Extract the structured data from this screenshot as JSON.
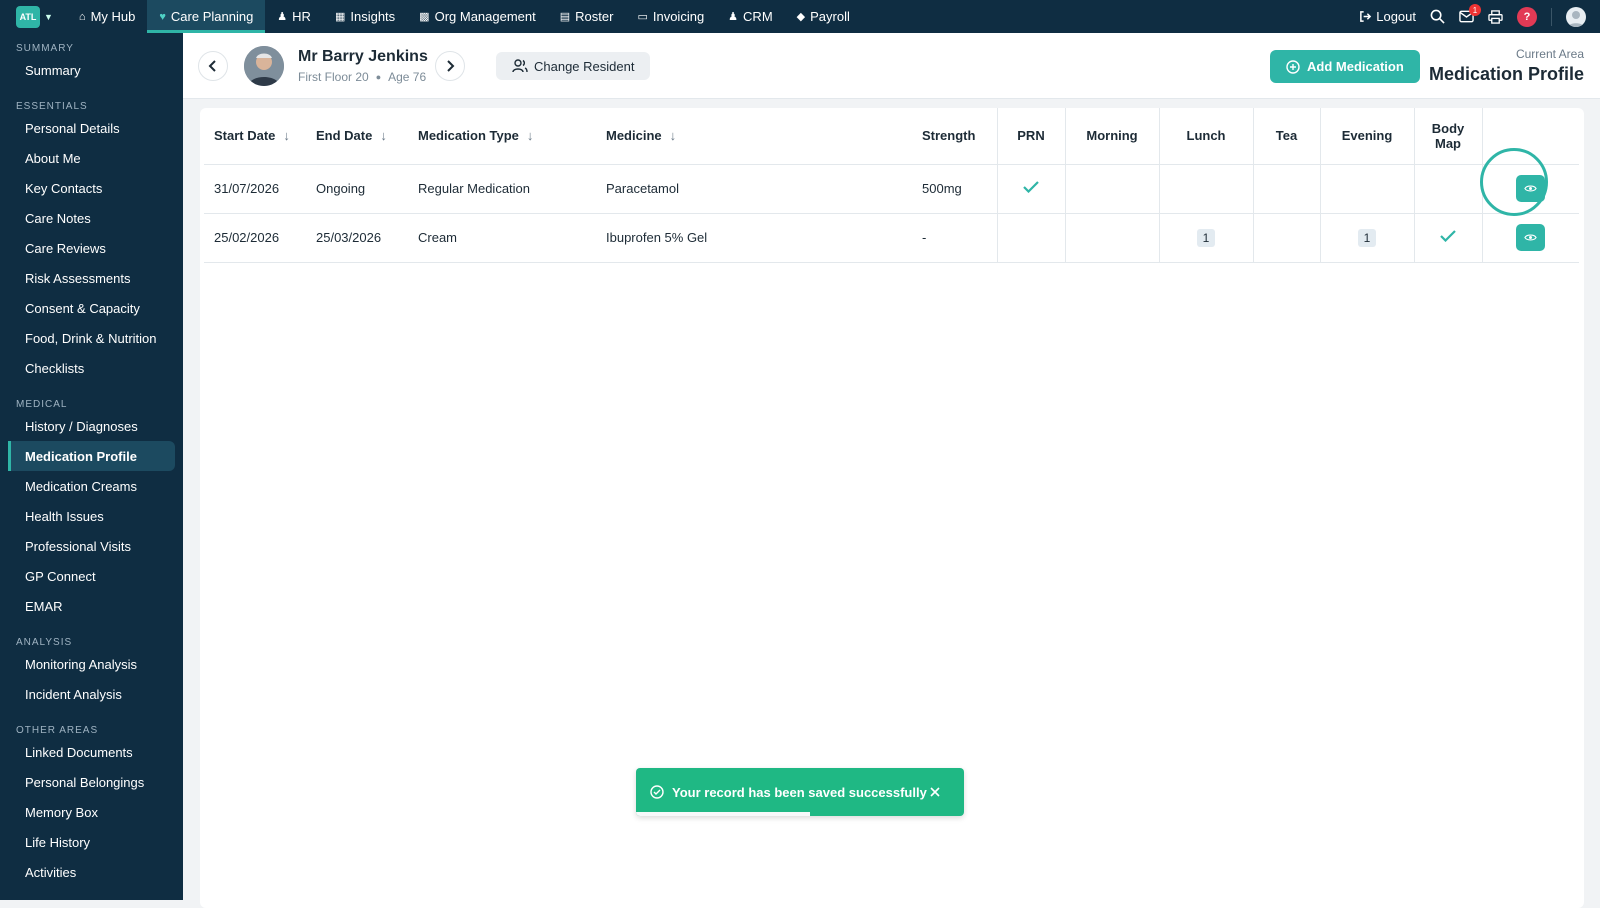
{
  "topnav": {
    "logo_text": "ATL",
    "items": [
      {
        "label": "My Hub",
        "icon": "home-icon"
      },
      {
        "label": "Care Planning",
        "icon": "heart-icon",
        "active": true
      },
      {
        "label": "HR",
        "icon": "users-icon"
      },
      {
        "label": "Insights",
        "icon": "chart-icon"
      },
      {
        "label": "Org Management",
        "icon": "building-icon"
      },
      {
        "label": "Roster",
        "icon": "calendar-icon"
      },
      {
        "label": "Invoicing",
        "icon": "file-icon"
      },
      {
        "label": "CRM",
        "icon": "user-icon"
      },
      {
        "label": "Payroll",
        "icon": "tag-icon"
      }
    ],
    "logout_label": "Logout",
    "mail_badge": "1",
    "help_label": "?"
  },
  "sidebar": {
    "sections": [
      {
        "title": "SUMMARY",
        "items": [
          "Summary"
        ]
      },
      {
        "title": "ESSENTIALS",
        "items": [
          "Personal Details",
          "About Me",
          "Key Contacts",
          "Care Notes",
          "Care Reviews",
          "Risk Assessments",
          "Consent & Capacity",
          "Food, Drink & Nutrition",
          "Checklists"
        ]
      },
      {
        "title": "MEDICAL",
        "items": [
          "History / Diagnoses",
          "Medication Profile",
          "Medication Creams",
          "Health Issues",
          "Professional Visits",
          "GP Connect",
          "EMAR"
        ]
      },
      {
        "title": "ANALYSIS",
        "items": [
          "Monitoring Analysis",
          "Incident Analysis"
        ]
      },
      {
        "title": "OTHER AREAS",
        "items": [
          "Linked Documents",
          "Personal Belongings",
          "Memory Box",
          "Life History",
          "Activities"
        ]
      }
    ],
    "active_item": "Medication Profile"
  },
  "resident": {
    "name": "Mr Barry Jenkins",
    "location": "First Floor 20",
    "age": "Age 76"
  },
  "header": {
    "change_resident_label": "Change Resident",
    "add_medication_label": "Add Medication",
    "current_area_label": "Current Area",
    "current_area_title": "Medication Profile"
  },
  "table": {
    "columns": [
      "Start Date",
      "End Date",
      "Medication Type",
      "Medicine",
      "Strength",
      "PRN",
      "Morning",
      "Lunch",
      "Tea",
      "Evening",
      "Body Map"
    ],
    "rows": [
      {
        "start_date": "31/07/2026",
        "end_date": "Ongoing",
        "type": "Regular Medication",
        "medicine": "Paracetamol",
        "strength": "500mg",
        "prn": true,
        "morning": "",
        "lunch": "",
        "tea": "",
        "evening": "",
        "body_map": false
      },
      {
        "start_date": "25/02/2026",
        "end_date": "25/03/2026",
        "type": "Cream",
        "medicine": "Ibuprofen 5% Gel",
        "strength": "-",
        "prn": false,
        "morning": "",
        "lunch": "1",
        "tea": "",
        "evening": "1",
        "body_map": true
      }
    ]
  },
  "toast": {
    "message": "Your record has been saved successfully",
    "progress": 0.53
  },
  "colors": {
    "nav_bg": "#0f2d42",
    "accent": "#2fb5a7",
    "success": "#1fb884"
  }
}
